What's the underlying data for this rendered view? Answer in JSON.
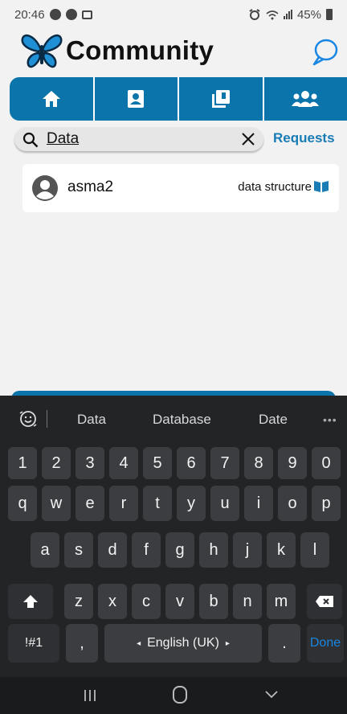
{
  "status_bar": {
    "time": "20:46",
    "battery": "45%"
  },
  "header": {
    "title": "Community"
  },
  "tabs": [
    {
      "name": "home",
      "icon": "home-icon"
    },
    {
      "name": "portfolio",
      "icon": "contact-book-icon"
    },
    {
      "name": "library",
      "icon": "library-icon"
    },
    {
      "name": "community",
      "icon": "people-icon"
    }
  ],
  "search": {
    "value": "Data",
    "requests_label": "Requests"
  },
  "results": [
    {
      "name": "asma2",
      "course": "data structure"
    }
  ],
  "keyboard": {
    "suggestions": [
      "Data",
      "Database",
      "Date"
    ],
    "row_numbers": [
      "1",
      "2",
      "3",
      "4",
      "5",
      "6",
      "7",
      "8",
      "9",
      "0"
    ],
    "row_q": [
      "q",
      "w",
      "e",
      "r",
      "t",
      "y",
      "u",
      "i",
      "o",
      "p"
    ],
    "row_a": [
      "a",
      "s",
      "d",
      "f",
      "g",
      "h",
      "j",
      "k",
      "l"
    ],
    "row_z": [
      "z",
      "x",
      "c",
      "v",
      "b",
      "n",
      "m"
    ],
    "symbols_label": "!#1",
    "comma_label": ",",
    "language_label": "English (UK)",
    "period_label": ".",
    "done_label": "Done"
  },
  "colors": {
    "accent": "#0b75ab",
    "link": "#1a7cb5",
    "keyboard_bg": "#222426"
  }
}
